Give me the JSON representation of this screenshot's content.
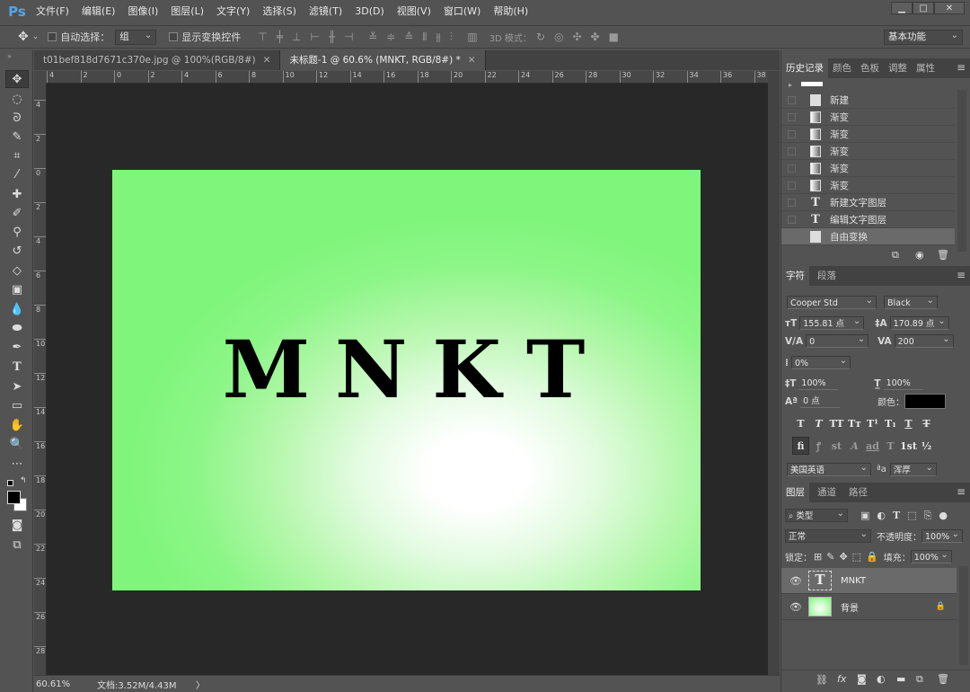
{
  "app": {
    "logo": "Ps"
  },
  "menu": [
    "文件(F)",
    "编辑(E)",
    "图像(I)",
    "图层(L)",
    "文字(Y)",
    "选择(S)",
    "滤镜(T)",
    "3D(D)",
    "视图(V)",
    "窗口(W)",
    "帮助(H)"
  ],
  "window_controls": {
    "minimize": "▁",
    "restore": "□",
    "close": "✕"
  },
  "options": {
    "auto_select_label": "自动选择：",
    "auto_select_value": "组",
    "show_transform_label": "显示变换控件",
    "mode3d_label": "3D 模式：",
    "workspace": "基本功能"
  },
  "tabs": [
    {
      "label": "t01bef818d7671c370e.jpg @ 100%(RGB/8#)",
      "close": "✕"
    },
    {
      "label": "未标题-1 @ 60.6% (MNKT, RGB/8#) *",
      "close": "✕"
    }
  ],
  "ruler_top": [
    "4",
    "2",
    "0",
    "2",
    "4",
    "6",
    "8",
    "10",
    "12",
    "14",
    "16",
    "18",
    "20",
    "22",
    "24",
    "26",
    "28",
    "30",
    "32",
    "34",
    "36",
    "38"
  ],
  "ruler_left": [
    "4",
    "2",
    "0",
    "2",
    "4",
    "6",
    "8",
    "10",
    "12",
    "14",
    "16",
    "18",
    "20",
    "22",
    "24",
    "26",
    "28"
  ],
  "canvas": {
    "text": "MNKT",
    "gradient_edge": "#7ff57b",
    "gradient_center": "#ffffff"
  },
  "status": {
    "zoom": "60.61%",
    "doc": "文档:3.52M/4.43M",
    "arrow": "〉"
  },
  "history": {
    "tabs": [
      "历史记录",
      "颜色",
      "色板",
      "调整",
      "属性"
    ],
    "items": [
      {
        "label": "新建",
        "icon": "doc"
      },
      {
        "label": "渐变",
        "icon": "gradient"
      },
      {
        "label": "渐变",
        "icon": "gradient"
      },
      {
        "label": "渐变",
        "icon": "gradient"
      },
      {
        "label": "渐变",
        "icon": "gradient"
      },
      {
        "label": "渐变",
        "icon": "gradient"
      },
      {
        "label": "新建文字图层",
        "icon": "text"
      },
      {
        "label": "编辑文字图层",
        "icon": "text"
      },
      {
        "label": "自由变换",
        "icon": "doc",
        "selected": true
      }
    ]
  },
  "character": {
    "tabs": [
      "字符",
      "段落"
    ],
    "font": "Cooper Std",
    "style": "Black",
    "size": "155.81 点",
    "leading": "170.89 点",
    "kerning": "0",
    "tracking": "200",
    "scale_percent": "0%",
    "vscale": "100%",
    "hscale": "100%",
    "baseline": "0 点",
    "color_label": "颜色：",
    "color": "#000000",
    "language": "美国英语",
    "aa_label": "ªa",
    "aa": "浑厚",
    "style_buttons": [
      "T",
      "T",
      "TT",
      "Tт",
      "T¹",
      "T₁",
      "T",
      "T"
    ],
    "ot_buttons": [
      "fi",
      "ꝭ",
      "st",
      "A",
      "ad",
      "T",
      "1st",
      "½"
    ]
  },
  "layers": {
    "tabs": [
      "图层",
      "通道",
      "路径"
    ],
    "filter": "类型",
    "blend": "正常",
    "opacity_label": "不透明度：",
    "opacity": "100%",
    "lock_label": "锁定：",
    "fill_label": "填充：",
    "fill": "100%",
    "items": [
      {
        "name": "MNKT",
        "type": "text",
        "selected": true
      },
      {
        "name": "背景",
        "type": "image",
        "locked": true
      }
    ]
  }
}
